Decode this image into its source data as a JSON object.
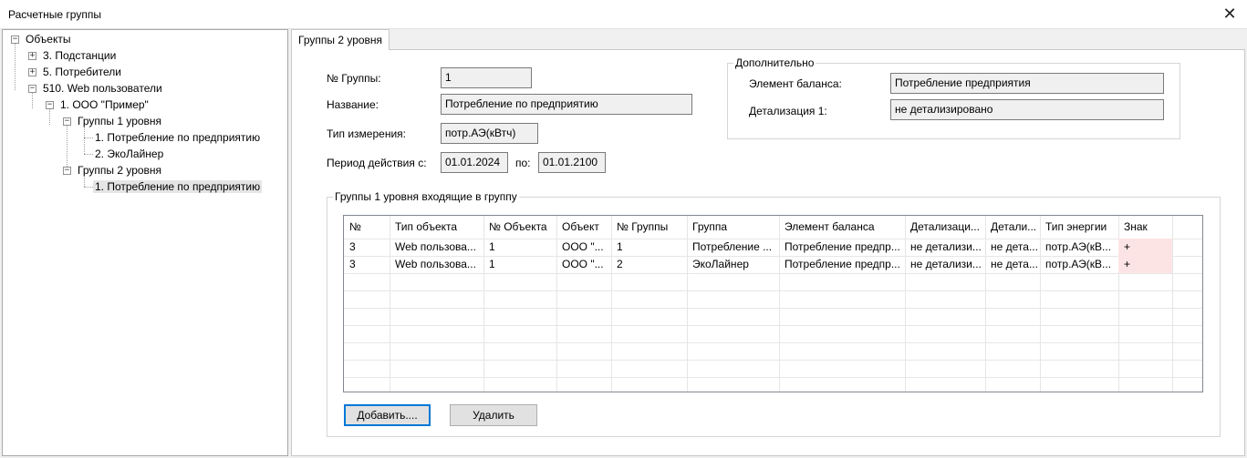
{
  "window": {
    "title": "Расчетные группы",
    "close_glyph": "✕"
  },
  "tree": {
    "nodes": [
      {
        "label": "Объекты",
        "expander": "−"
      },
      {
        "label": "3. Подстанции",
        "expander": "+"
      },
      {
        "label": "5. Потребители",
        "expander": "+"
      },
      {
        "label": "510. Web пользователи",
        "expander": "−"
      },
      {
        "label": "1. ООО \"Пример\"",
        "expander": "−"
      },
      {
        "label": "Группы 1 уровня",
        "expander": "−"
      },
      {
        "label": "1. Потребление по предприятию"
      },
      {
        "label": "2. ЭкоЛайнер"
      },
      {
        "label": "Группы 2 уровня",
        "expander": "−"
      },
      {
        "label": "1. Потребление по предприятию"
      }
    ]
  },
  "tab": {
    "label": "Группы 2 уровня"
  },
  "form": {
    "group_no_label": "№ Группы:",
    "group_no_value": "1",
    "name_label": "Название:",
    "name_value": "Потребление по предприятию",
    "measure_label": "Тип измерения:",
    "measure_value": "потр.АЭ(кВтч)",
    "period_label": "Период действия с:",
    "period_from": "01.01.2024",
    "period_to_label": "по:",
    "period_to": "01.01.2100"
  },
  "extra": {
    "title": "Дополнительно",
    "balance_label": "Элемент баланса:",
    "balance_value": "Потребление предприятия",
    "detail_label": "Детализация 1:",
    "detail_value": "не детализировано"
  },
  "included": {
    "title": "Группы 1 уровня входящие в группу",
    "columns": [
      "№",
      "Тип объекта",
      "№ Объекта",
      "Объект",
      "№ Группы",
      "Группа",
      "Элемент баланса",
      "Детализаци...",
      "Детали...",
      "Тип энергии",
      "Знак"
    ],
    "rows": [
      [
        "3",
        "Web пользова...",
        "1",
        "ООО \"...",
        "1",
        "Потребление ...",
        "Потребление предпр...",
        "не детализи...",
        "не дета...",
        "потр.АЭ(кВ...",
        "+"
      ],
      [
        "3",
        "Web пользова...",
        "1",
        "ООО \"...",
        "2",
        "ЭкоЛайнер",
        "Потребление предпр...",
        "не детализи...",
        "не дета...",
        "потр.АЭ(кВ...",
        "+"
      ]
    ]
  },
  "buttons": {
    "add": "Добавить....",
    "delete": "Удалить"
  }
}
